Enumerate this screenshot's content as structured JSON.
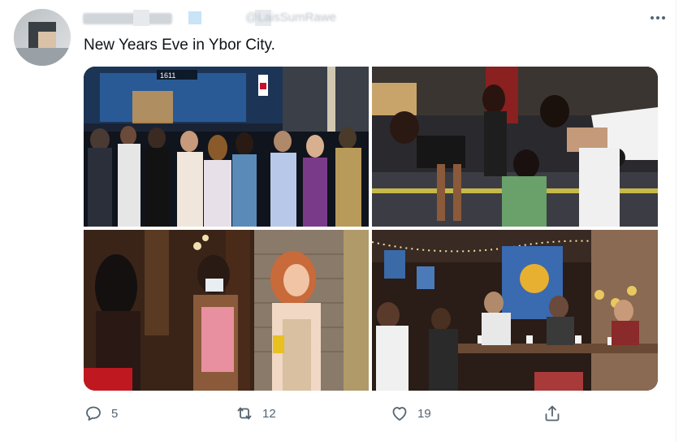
{
  "tweet": {
    "text": "New Years Eve in Ybor City.",
    "handle": "@LaisSumRawe",
    "more_icon": "more-horizontal-icon",
    "photo_sign": "1611"
  },
  "actions": {
    "reply_count": "5",
    "retweet_count": "12",
    "like_count": "19"
  },
  "colors": {
    "text": "#0f1419",
    "secondary": "#536471",
    "border": "#eff3f4"
  }
}
